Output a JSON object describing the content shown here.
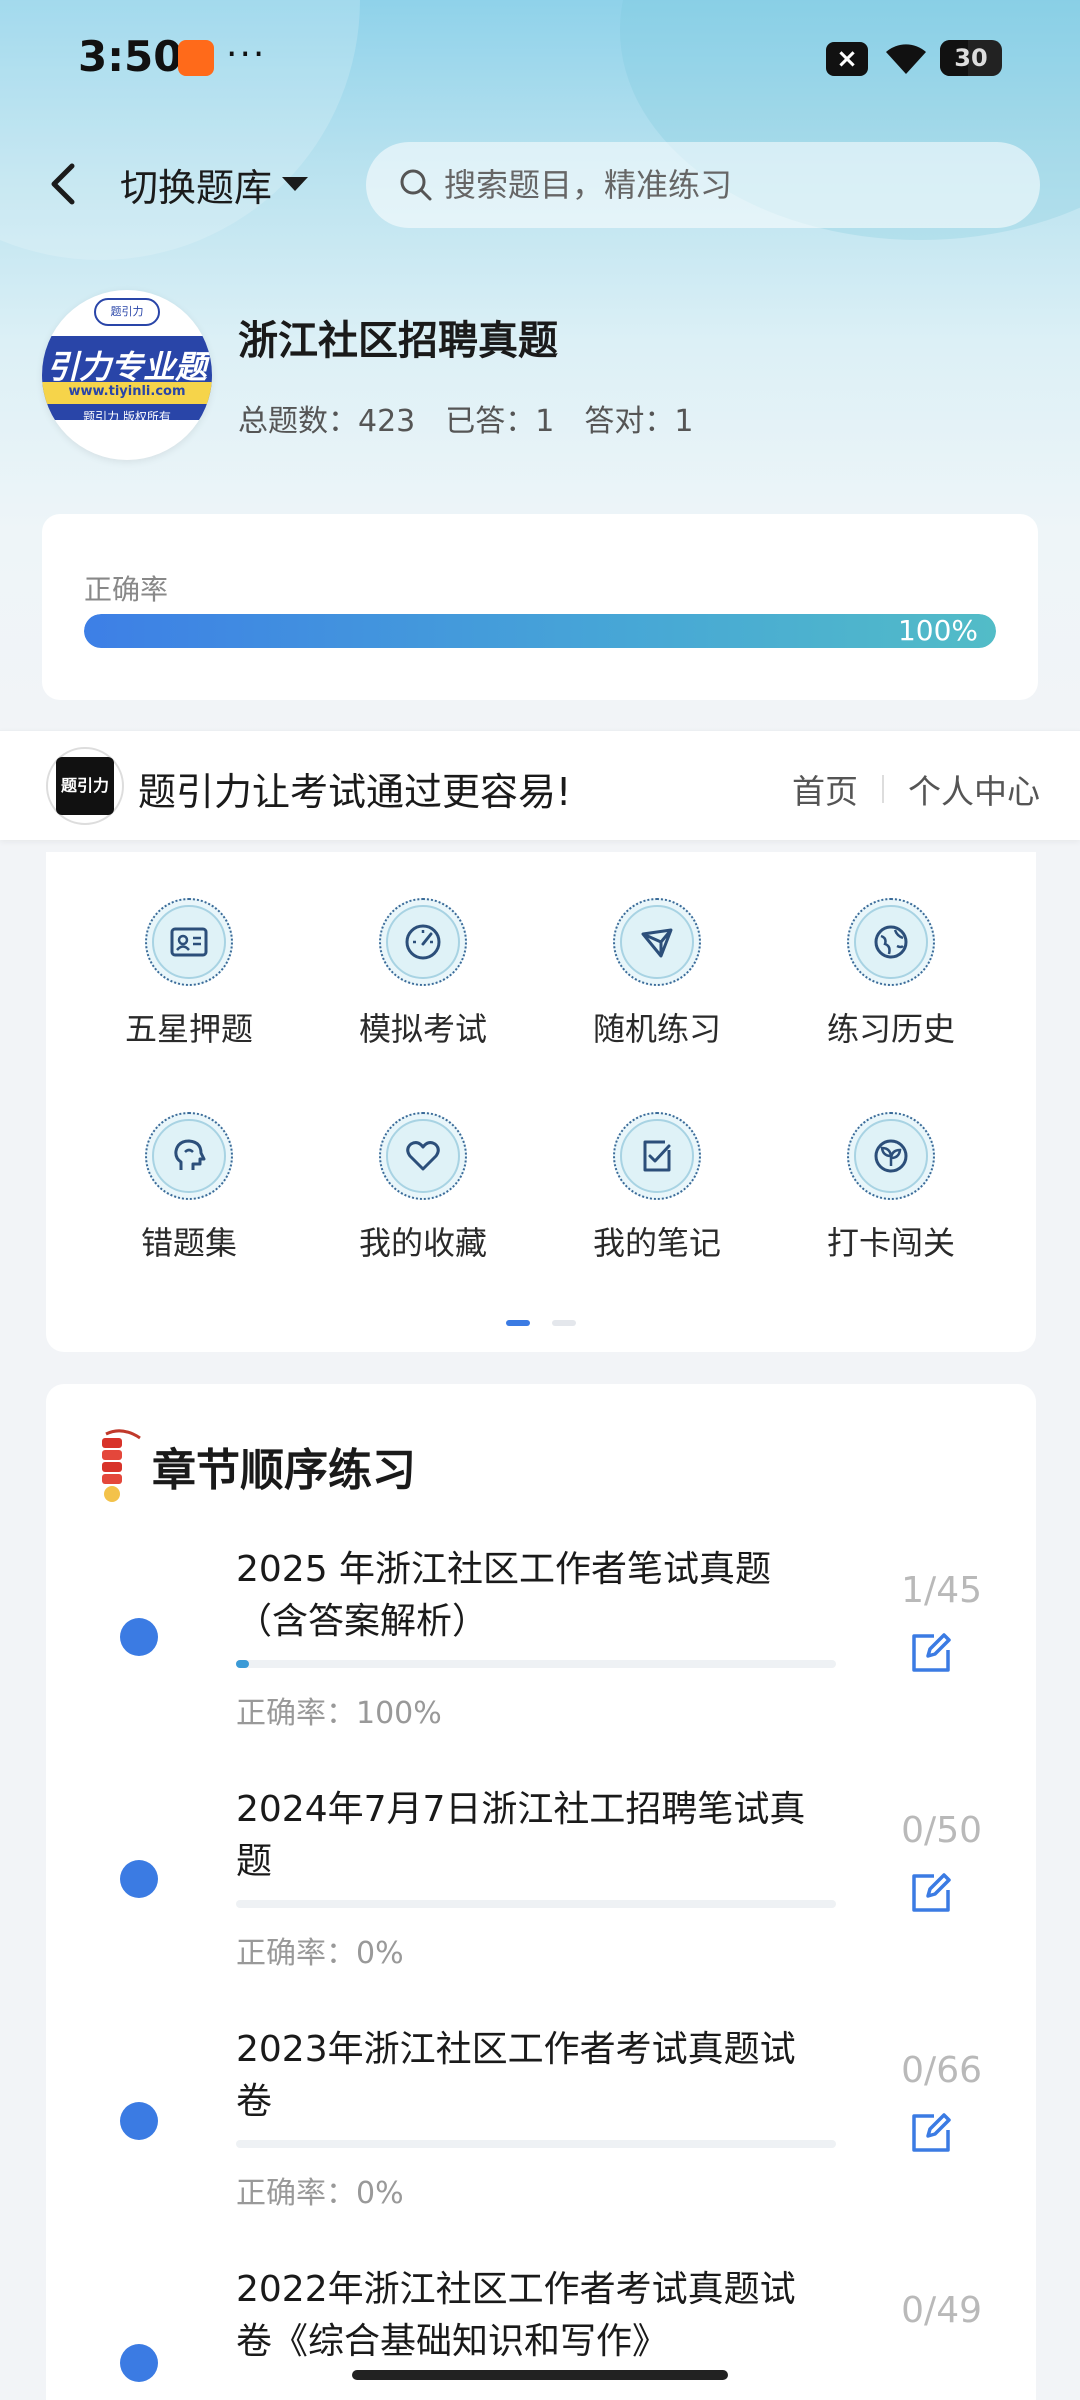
{
  "status_bar": {
    "time": "3:50",
    "dots": "···",
    "battery": "30"
  },
  "top_bar": {
    "switch_label": "切换题库",
    "search_placeholder": "搜索题目，精准练习"
  },
  "bank": {
    "logo_brand": "引力专业题",
    "logo_url": "www.tiyinli.com",
    "logo_copyright": "题引力 版权所有",
    "title": "浙江社区招聘真题",
    "stats": [
      {
        "label": "总题数：",
        "value": "423"
      },
      {
        "label": "已答：",
        "value": "1"
      },
      {
        "label": "答对：",
        "value": "1"
      }
    ]
  },
  "accuracy": {
    "label": "正确率",
    "value_text": "100%",
    "fraction": 1.0
  },
  "brand_bar": {
    "logo_text": "题引力",
    "slogan": "题引力让考试通过更容易!",
    "nav": [
      "首页",
      "个人中心"
    ]
  },
  "functions": [
    {
      "label": "五星押题",
      "icon": "id-card-icon"
    },
    {
      "label": "模拟考试",
      "icon": "speedometer-icon"
    },
    {
      "label": "随机练习",
      "icon": "network-icon"
    },
    {
      "label": "练习历史",
      "icon": "globe-icon"
    },
    {
      "label": "错题集",
      "icon": "head-icon"
    },
    {
      "label": "我的收藏",
      "icon": "heart-icon"
    },
    {
      "label": "我的笔记",
      "icon": "note-check-icon"
    },
    {
      "label": "打卡闯关",
      "icon": "sprout-icon"
    }
  ],
  "pager": {
    "active": 0,
    "count": 2
  },
  "chapters": {
    "title": "章节顺序练习",
    "items": [
      {
        "name": "2025 年浙江社区工作者笔试真题（含答案解析）",
        "count": "1/45",
        "progress": 0.022,
        "accuracy": "正确率：100%"
      },
      {
        "name": "2024年7月7日浙江社工招聘笔试真题",
        "count": "0/50",
        "progress": 0,
        "accuracy": "正确率：0%"
      },
      {
        "name": "2023年浙江社区工作者考试真题试卷",
        "count": "0/66",
        "progress": 0,
        "accuracy": "正确率：0%"
      },
      {
        "name": "2022年浙江社区工作者考试真题试卷《综合基础知识和写作》",
        "count": "0/49",
        "progress": 0,
        "accuracy": ""
      }
    ]
  },
  "colors": {
    "accent": "#3b7be3",
    "progress_end": "#52bcc7"
  }
}
